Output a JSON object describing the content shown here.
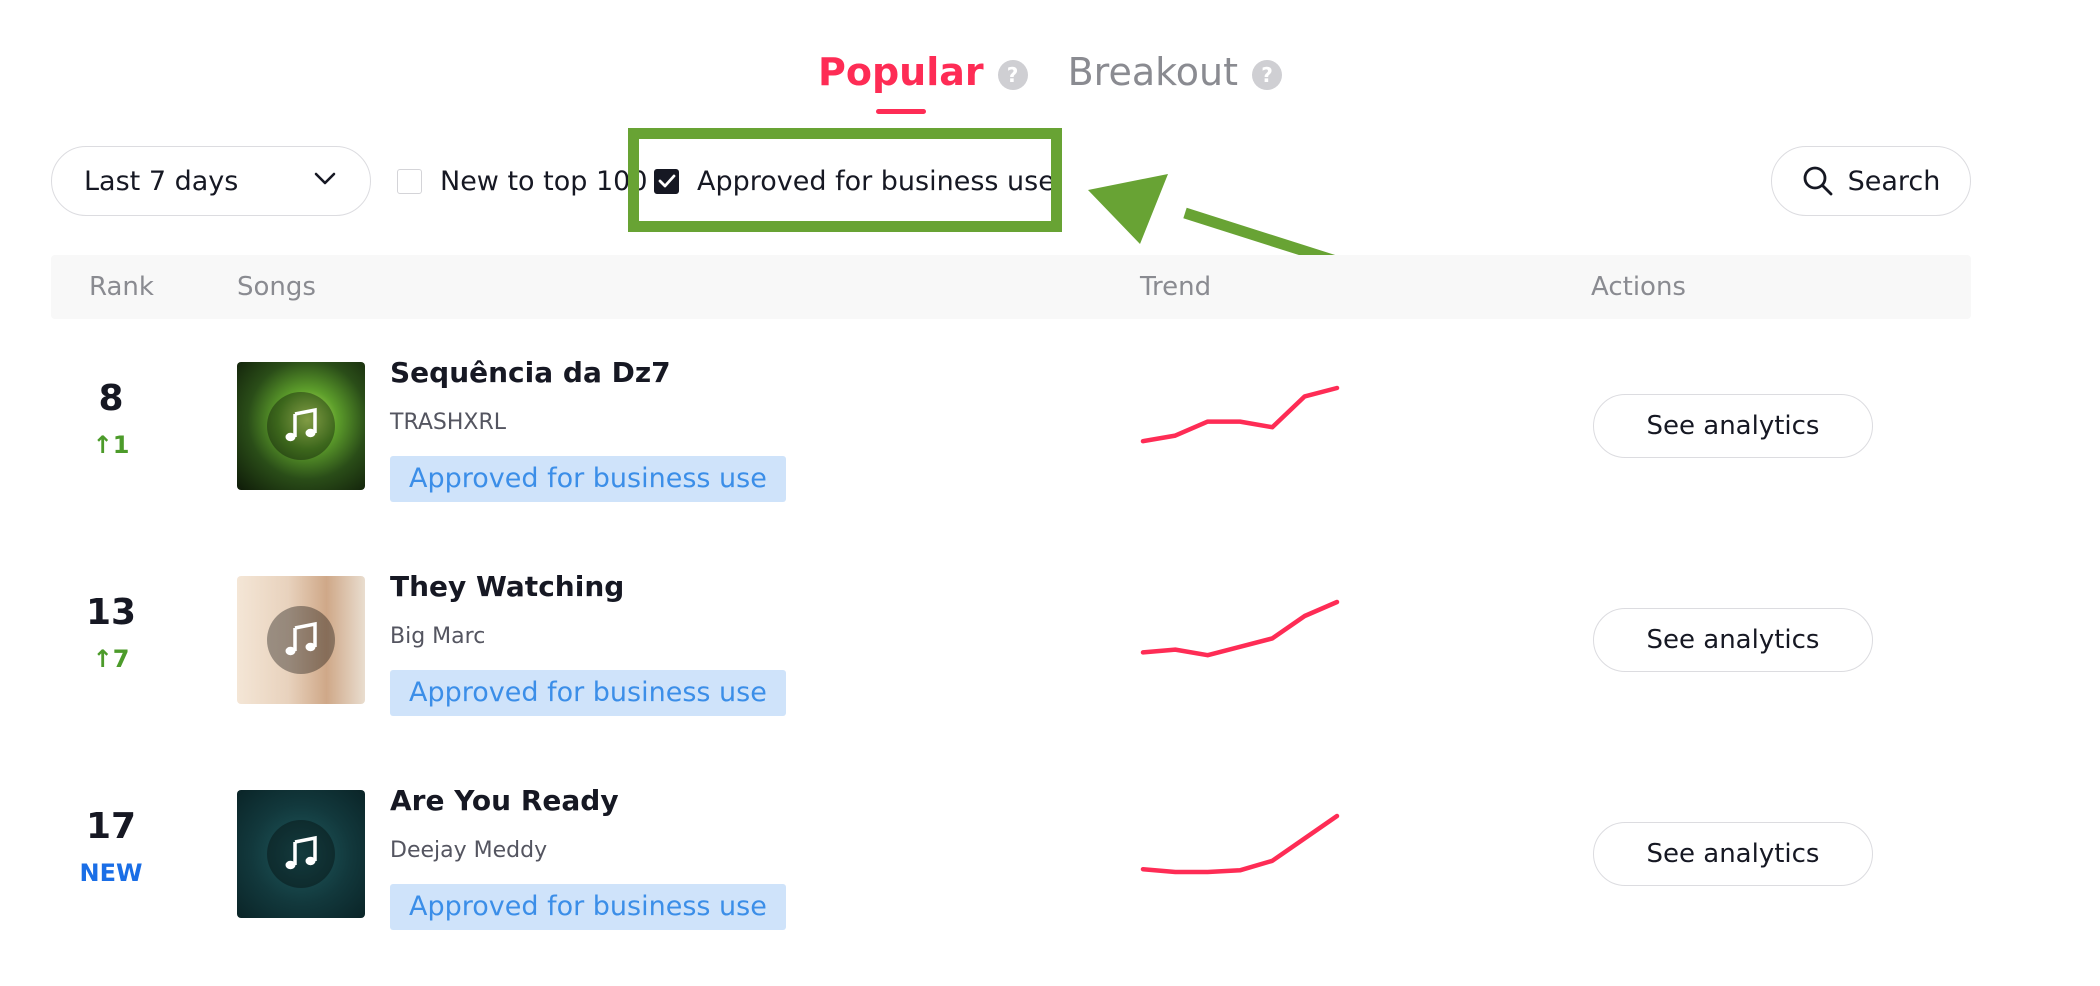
{
  "tabs": [
    {
      "label": "Popular",
      "active": true
    },
    {
      "label": "Breakout",
      "active": false
    }
  ],
  "filters": {
    "period_label": "Last 7 days",
    "new_to_top_label": "New to top 100",
    "new_to_top_checked": false,
    "approved_label": "Approved for business use",
    "approved_checked": true,
    "search_label": "Search"
  },
  "table": {
    "headers": {
      "rank": "Rank",
      "songs": "Songs",
      "trend": "Trend",
      "actions": "Actions"
    },
    "rows": [
      {
        "rank": "8",
        "change": "↑1",
        "change_type": "up",
        "title": "Sequência da Dz7",
        "artist": "TRASHXRL",
        "badge": "Approved for business use",
        "action": "See analytics",
        "trend": [
          0.05,
          0.15,
          0.4,
          0.4,
          0.3,
          0.85,
          1.0
        ]
      },
      {
        "rank": "13",
        "change": "↑7",
        "change_type": "up",
        "title": "They Watching",
        "artist": "Big Marc",
        "badge": "Approved for business use",
        "action": "See analytics",
        "trend": [
          0.1,
          0.15,
          0.05,
          0.2,
          0.35,
          0.75,
          1.0
        ]
      },
      {
        "rank": "17",
        "change": "NEW",
        "change_type": "new",
        "title": "Are You Ready",
        "artist": "Deejay Meddy",
        "badge": "Approved for business use",
        "action": "See analytics",
        "trend": [
          0.05,
          0.0,
          0.0,
          0.03,
          0.2,
          0.6,
          1.0
        ]
      }
    ]
  },
  "colors": {
    "accent": "#fe2c55",
    "badge_bg": "#cfe3fa",
    "badge_text": "#3b8ee8",
    "rank_up": "#4c9b2a",
    "rank_new": "#1a6ee6",
    "annotation": "#68a334"
  }
}
